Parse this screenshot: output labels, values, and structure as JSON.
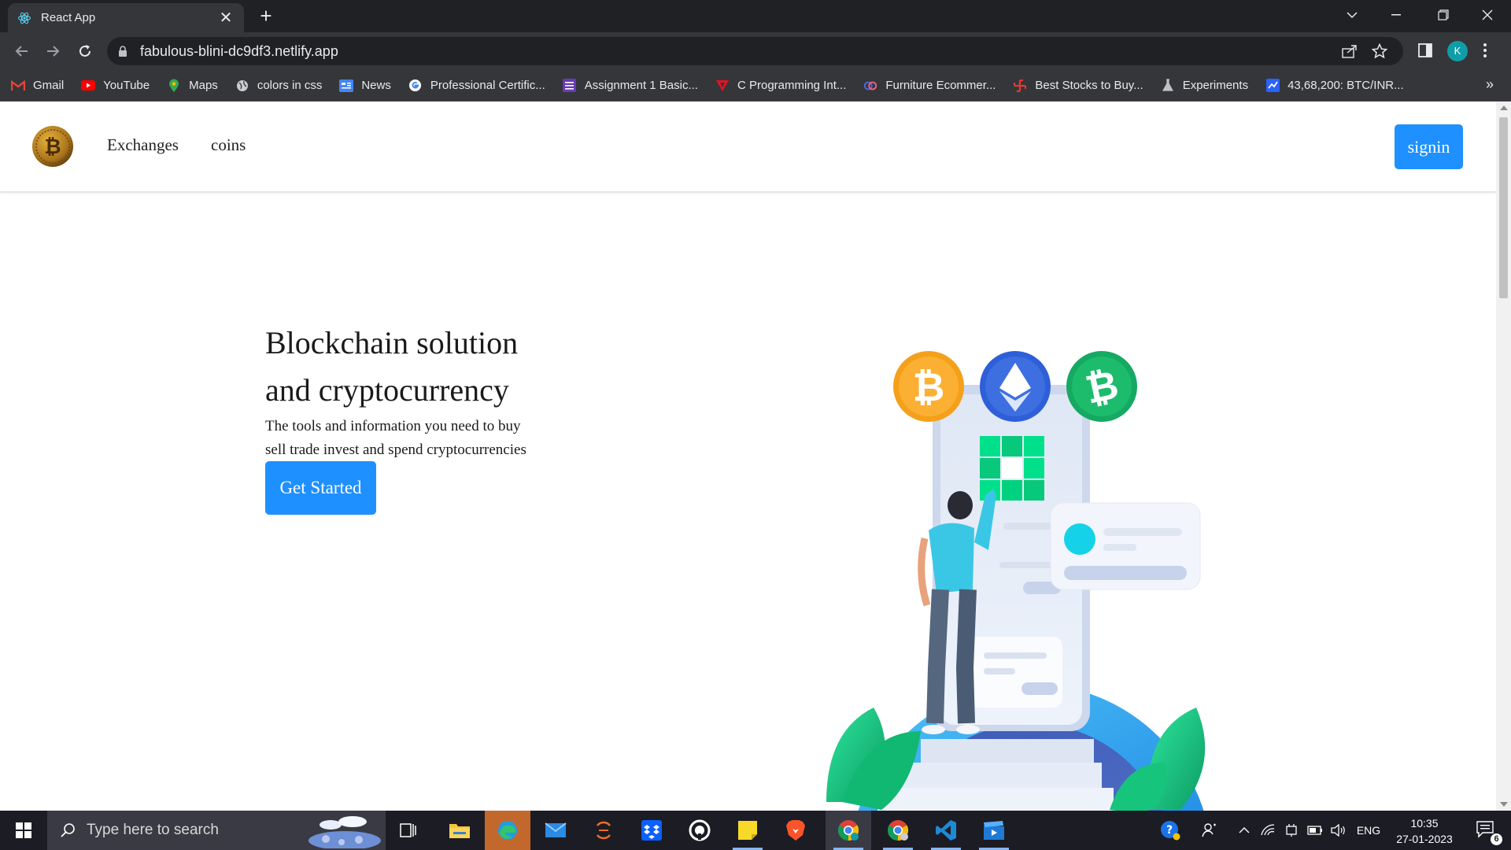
{
  "browser": {
    "tab_title": "React App",
    "url": "fabulous-blini-dc9df3.netlify.app",
    "profile_initial": "K",
    "bookmarks": [
      {
        "label": "Gmail",
        "icon": "gmail-icon"
      },
      {
        "label": "YouTube",
        "icon": "youtube-icon"
      },
      {
        "label": "Maps",
        "icon": "maps-icon"
      },
      {
        "label": "colors in css",
        "icon": "globe-icon"
      },
      {
        "label": "News",
        "icon": "news-icon"
      },
      {
        "label": "Professional Certific...",
        "icon": "google-icon"
      },
      {
        "label": "Assignment 1 Basic...",
        "icon": "list-icon"
      },
      {
        "label": "C Programming Int...",
        "icon": "triangle-logo-icon"
      },
      {
        "label": "Furniture Ecommer...",
        "icon": "rings-icon"
      },
      {
        "label": "Best Stocks to Buy...",
        "icon": "stocks-icon"
      },
      {
        "label": "Experiments",
        "icon": "flask-icon"
      },
      {
        "label": "43,68,200: BTC/INR...",
        "icon": "chart-icon"
      }
    ],
    "more_bookmarks": "»"
  },
  "site": {
    "nav": {
      "exchanges": "Exchanges",
      "coins": "coins",
      "signin": "signin"
    },
    "hero": {
      "title_line1": "Blockchain solution",
      "title_line2": "and cryptocurrency",
      "subtitle_line1": "The tools and information you need to buy",
      "subtitle_line2": "sell trade invest and spend cryptocurrencies",
      "cta": "Get Started"
    },
    "colors": {
      "accent": "#1e90ff",
      "bitcoin": "#f7931a",
      "ethereum": "#3d6fe0",
      "bitcoin_cash": "#1cbc6c"
    }
  },
  "taskbar": {
    "search_placeholder": "Type here to search",
    "language": "ENG",
    "time": "10:35",
    "date": "27-01-2023",
    "notification_count": "6"
  }
}
